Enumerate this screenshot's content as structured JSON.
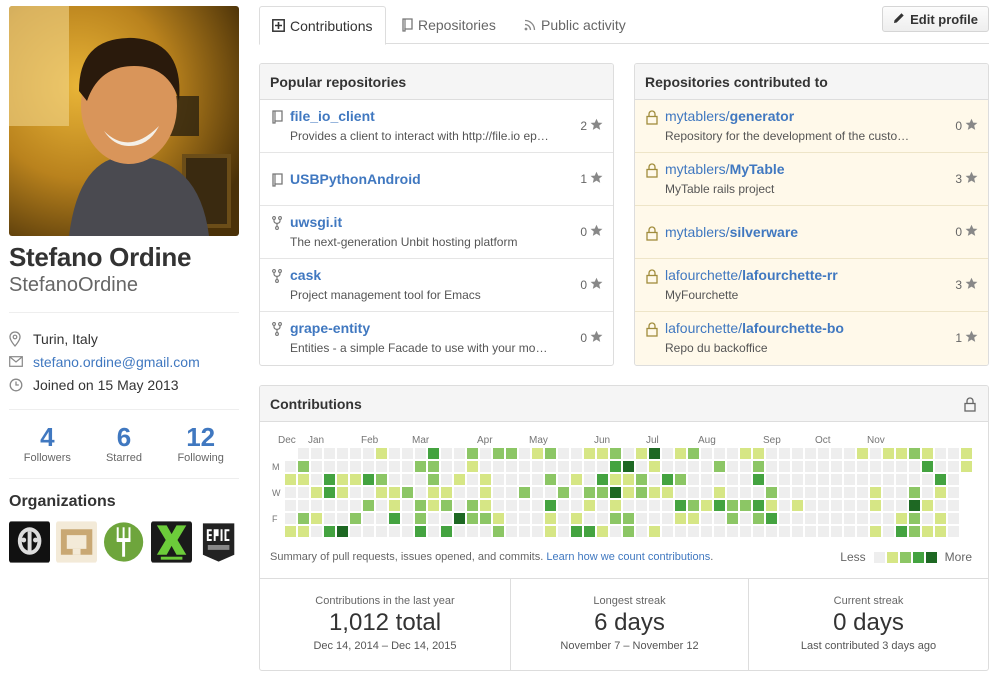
{
  "profile": {
    "full_name": "Stefano Ordine",
    "username": "StefanoOrdine",
    "location": "Turin, Italy",
    "email": "stefano.ordine@gmail.com",
    "joined": "Joined on 15 May 2013"
  },
  "stats": [
    {
      "num": "4",
      "label": "Followers"
    },
    {
      "num": "6",
      "label": "Starred"
    },
    {
      "num": "12",
      "label": "Following"
    }
  ],
  "organizations": {
    "title": "Organizations",
    "items": [
      {
        "icon": "org-helmet-icon",
        "color": "#111111"
      },
      {
        "icon": "org-arch-icon",
        "color": "#d8cbb0"
      },
      {
        "icon": "org-fork-icon",
        "color": "#6ea53c"
      },
      {
        "icon": "org-xteam-icon",
        "color": "#1a1a1a"
      },
      {
        "icon": "org-epic-games-icon",
        "color": "#222222"
      }
    ]
  },
  "tabs": [
    {
      "label": "Contributions",
      "icon": "plus-square-icon",
      "selected": true
    },
    {
      "label": "Repositories",
      "icon": "repo-icon",
      "selected": false
    },
    {
      "label": "Public activity",
      "icon": "rss-icon",
      "selected": false
    }
  ],
  "edit_profile": "Edit profile",
  "popular": {
    "title": "Popular repositories",
    "repos": [
      {
        "name": "file_io_client",
        "desc": "Provides a client to interact with http://file.io ep…",
        "stars": "2",
        "icon": "repo-icon"
      },
      {
        "name": "USBPythonAndroid",
        "desc": "",
        "stars": "1",
        "icon": "repo-icon"
      },
      {
        "name": "uwsgi.it",
        "desc": "The next-generation Unbit hosting platform",
        "stars": "0",
        "icon": "fork-icon"
      },
      {
        "name": "cask",
        "desc": "Project management tool for Emacs",
        "stars": "0",
        "icon": "fork-icon"
      },
      {
        "name": "grape-entity",
        "desc": "Entities - a simple Facade to use with your mo…",
        "stars": "0",
        "icon": "fork-icon"
      }
    ]
  },
  "contributed": {
    "title": "Repositories contributed to",
    "repos": [
      {
        "owner": "mytablers/",
        "name": "generator",
        "desc": "Repository for the development of the custom …",
        "stars": "0"
      },
      {
        "owner": "mytablers/",
        "name": "MyTable",
        "desc": "MyTable rails project",
        "stars": "3"
      },
      {
        "owner": "mytablers/",
        "name": "silverware",
        "desc": "",
        "stars": "0"
      },
      {
        "owner": "lafourchette/",
        "name": "lafourchette-rr",
        "desc": "MyFourchette",
        "stars": "3"
      },
      {
        "owner": "lafourchette/",
        "name": "lafourchette-bo",
        "desc": "Repo du backoffice",
        "stars": "1"
      }
    ]
  },
  "contributions": {
    "title": "Contributions",
    "months": [
      "Dec",
      "Jan",
      "Feb",
      "Mar",
      "Apr",
      "May",
      "Jun",
      "Jul",
      "Aug",
      "Sep",
      "Oct",
      "Nov"
    ],
    "weekdays": [
      "M",
      "W",
      "F"
    ],
    "summary_text": "Summary of pull requests, issues opened, and commits.",
    "summary_link": "Learn how we count contributions",
    "summary_end": ".",
    "legend_less": "Less",
    "legend_more": "More",
    "colors": [
      "#eeeeee",
      "#d6e685",
      "#8cc665",
      "#44a340",
      "#1e6823"
    ],
    "stats": [
      {
        "title": "Contributions in the last year",
        "big": "1,012 total",
        "sub": "Dec 14, 2014 – Dec 14, 2015"
      },
      {
        "title": "Longest streak",
        "big": "6 days",
        "sub": "November 7 – November 12"
      },
      {
        "title": "Current streak",
        "big": "0 days",
        "sub": "Last contributed 3 days ago"
      }
    ]
  }
}
